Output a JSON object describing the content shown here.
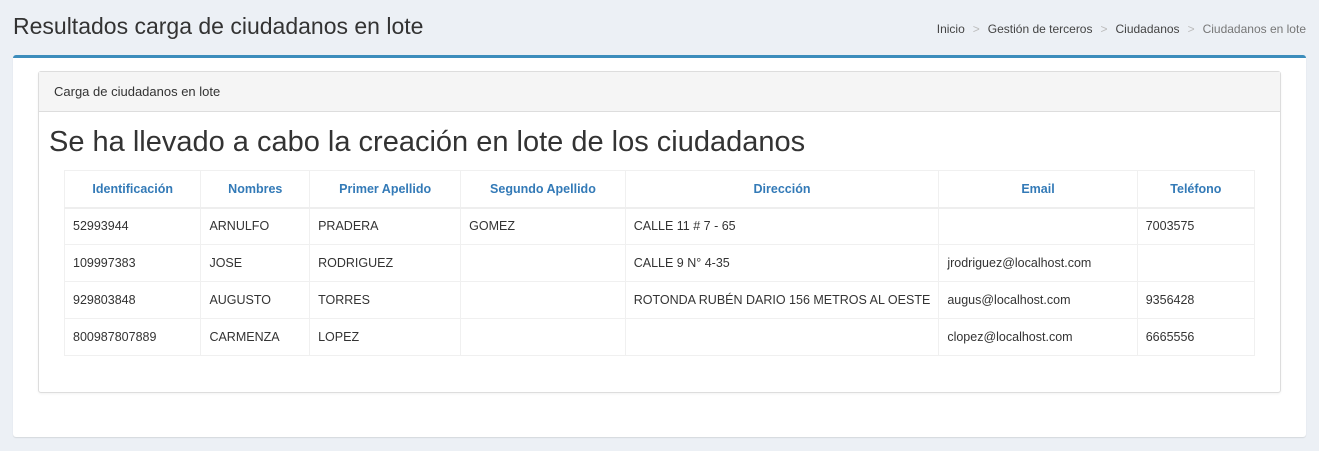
{
  "header": {
    "title": "Resultados carga de ciudadanos en lote",
    "breadcrumb": [
      {
        "label": "Inicio"
      },
      {
        "label": "Gestión de terceros"
      },
      {
        "label": "Ciudadanos"
      },
      {
        "label": "Ciudadanos en lote"
      }
    ],
    "breadcrumb_separator": ">"
  },
  "panel": {
    "heading": "Carga de ciudadanos en lote",
    "message": "Se ha llevado a cabo la creación en lote de los ciudadanos"
  },
  "table": {
    "columns": [
      "Identificación",
      "Nombres",
      "Primer Apellido",
      "Segundo Apellido",
      "Dirección",
      "Email",
      "Teléfono"
    ],
    "rows": [
      [
        "52993944",
        "ARNULFO",
        "PRADERA",
        "GOMEZ",
        "CALLE 11 # 7 - 65",
        "",
        "7003575"
      ],
      [
        "109997383",
        "JOSE",
        "RODRIGUEZ",
        "",
        "CALLE 9 N° 4-35",
        "jrodriguez@localhost.com",
        ""
      ],
      [
        "929803848",
        "AUGUSTO",
        "TORRES",
        "",
        "ROTONDA RUBÉN DARIO 156 METROS AL OESTE",
        "augus@localhost.com",
        "9356428"
      ],
      [
        "800987807889",
        "CARMENZA",
        "LOPEZ",
        "",
        "",
        "clopez@localhost.com",
        "6665556"
      ]
    ]
  },
  "colors": {
    "accent": "#3c8dbc",
    "header_link": "#337ab7",
    "background": "#ecf0f5"
  }
}
